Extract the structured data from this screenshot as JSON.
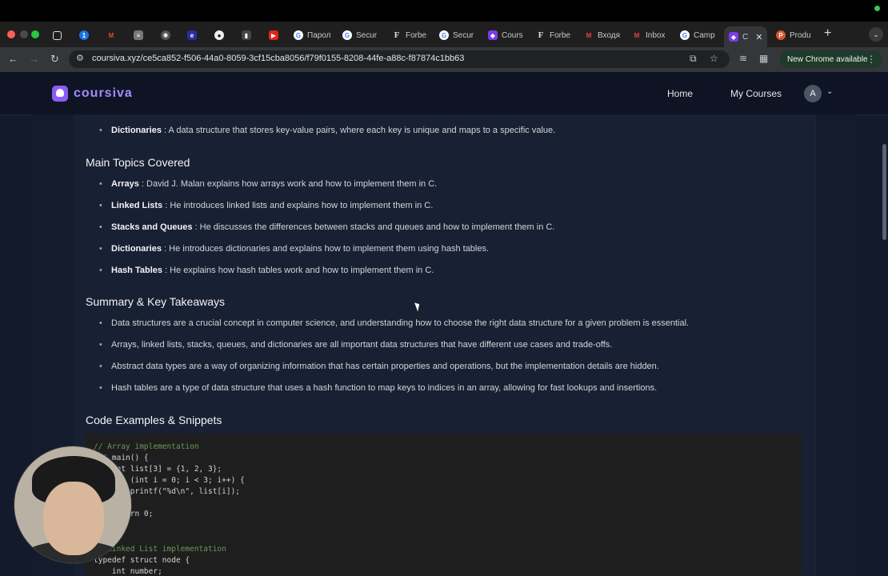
{
  "browser": {
    "tabs": [
      {
        "label": "",
        "icon": "sidebar-icon"
      },
      {
        "label": "",
        "icon": "onepassword-icon"
      },
      {
        "label": "",
        "icon": "gmail-icon"
      },
      {
        "label": "",
        "icon": "doc-icon"
      },
      {
        "label": "",
        "icon": "chatgpt-icon"
      },
      {
        "label": "",
        "icon": "e-icon"
      },
      {
        "label": "",
        "icon": "github-icon"
      },
      {
        "label": "",
        "icon": "app-icon"
      },
      {
        "label": "",
        "icon": "youtube-icon"
      },
      {
        "label": "Парол",
        "icon": "google-icon"
      },
      {
        "label": "Secur",
        "icon": "google-icon"
      },
      {
        "label": "Forbe",
        "icon": "forbes-icon"
      },
      {
        "label": "Secur",
        "icon": "google-icon"
      },
      {
        "label": "Cours",
        "icon": "coursiva-icon"
      },
      {
        "label": "Forbe",
        "icon": "forbes-icon"
      },
      {
        "label": "Входя",
        "icon": "gmail-icon"
      },
      {
        "label": "Inbox",
        "icon": "gmail-icon"
      },
      {
        "label": "Camp",
        "icon": "google-icon"
      },
      {
        "label": "C",
        "icon": "coursiva-icon"
      },
      {
        "label": "Produ",
        "icon": "producthunt-icon"
      }
    ],
    "url": "coursiva.xyz/ce5ca852-f506-44a0-8059-3cf15cba8056/f79f0155-8208-44fe-a88c-f87874c1bb63",
    "update_label": "New Chrome available"
  },
  "site": {
    "logo": "coursiva",
    "nav": {
      "home": "Home",
      "my_courses": "My Courses"
    },
    "avatar_initial": "A"
  },
  "content": {
    "top_item": {
      "term": "Dictionaries",
      "desc": ": A data structure that stores key-value pairs, where each key is unique and maps to a specific value."
    },
    "topics": {
      "heading": "Main Topics Covered",
      "items": [
        {
          "term": "Arrays",
          "desc": ": David J. Malan explains how arrays work and how to implement them in C."
        },
        {
          "term": "Linked Lists",
          "desc": ": He introduces linked lists and explains how to implement them in C."
        },
        {
          "term": "Stacks and Queues",
          "desc": ": He discusses the differences between stacks and queues and how to implement them in C."
        },
        {
          "term": "Dictionaries",
          "desc": ": He introduces dictionaries and explains how to implement them using hash tables."
        },
        {
          "term": "Hash Tables",
          "desc": ": He explains how hash tables work and how to implement them in C."
        }
      ]
    },
    "summary": {
      "heading": "Summary & Key Takeaways",
      "items": [
        "Data structures are a crucial concept in computer science, and understanding how to choose the right data structure for a given problem is essential.",
        "Arrays, linked lists, stacks, queues, and dictionaries are all important data structures that have different use cases and trade-offs.",
        "Abstract data types are a way of organizing information that has certain properties and operations, but the implementation details are hidden.",
        "Hash tables are a type of data structure that uses a hash function to map keys to indices in an array, allowing for fast lookups and insertions."
      ]
    },
    "code": {
      "heading": "Code Examples & Snippets",
      "lines": [
        "// Array implementation",
        "int main() {",
        "    int list[3] = {1, 2, 3};",
        "    for (int i = 0; i < 3; i++) {",
        "        printf(\"%d\\n\", list[i]);",
        "    }",
        "    return 0;",
        "}",
        "",
        "// Linked List implementation",
        "typedef struct node {",
        "    int number;"
      ]
    }
  }
}
